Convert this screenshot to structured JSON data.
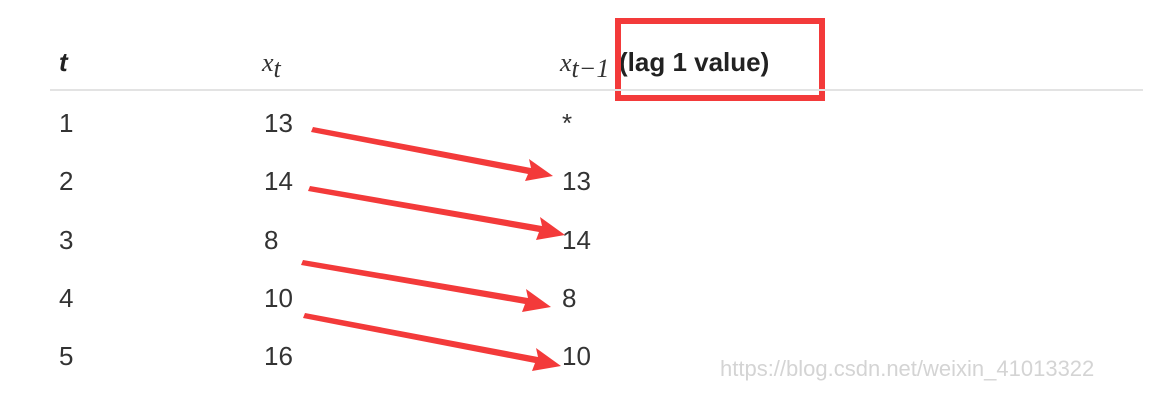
{
  "table": {
    "headers": {
      "t": "t",
      "x_base": "x",
      "x_sub": "t",
      "lag_base": "x",
      "lag_sub": "t−1",
      "lag_note": "(lag 1 value)"
    },
    "rows": [
      {
        "t": "1",
        "x": "13",
        "lag": "*"
      },
      {
        "t": "2",
        "x": "14",
        "lag": "13"
      },
      {
        "t": "3",
        "x": "8",
        "lag": "14"
      },
      {
        "t": "4",
        "x": "10",
        "lag": "8"
      },
      {
        "t": "5",
        "x": "16",
        "lag": "10"
      }
    ]
  },
  "annotation": {
    "color": "#f33a3a"
  },
  "watermark": "https://blog.csdn.net/weixin_41013322"
}
